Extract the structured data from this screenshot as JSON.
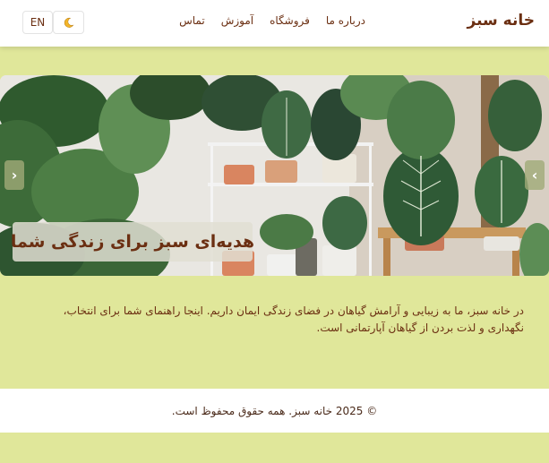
{
  "header": {
    "brand": "خانه سبز",
    "nav": [
      "درباره ما",
      "فروشگاه",
      "آموزش",
      "تماس"
    ],
    "lang_button": "EN",
    "theme_icon": "moon-icon"
  },
  "hero": {
    "caption": "هدیه‌ای سبز برای زندگی شما",
    "prev_arrow": "‹",
    "next_arrow": "›"
  },
  "intro": {
    "text": "در خانه سبز، ما به زیبایی و آرامش گیاهان در فضای زندگی ایمان داریم. اینجا راهنمای شما برای انتخاب، نگهداری و لذت بردن از گیاهان آپارتمانی است."
  },
  "footer": {
    "text": "© 2025 خانه سبز. همه حقوق محفوظ است."
  },
  "colors": {
    "page_bg": "#e0e79a",
    "text_brown": "#6b2f12",
    "header_bg": "#ffffff"
  }
}
